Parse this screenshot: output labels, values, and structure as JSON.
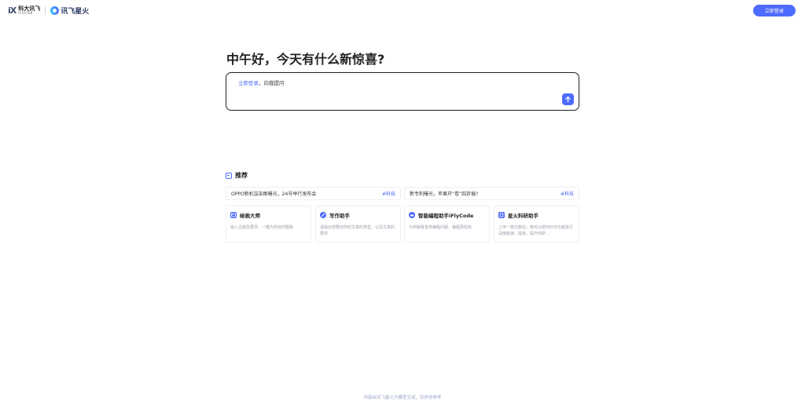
{
  "header": {
    "logo_cn": "科大讯飞",
    "logo_en": "iFLYTEK",
    "logo_x": "iX",
    "spark_name": "讯飞星火",
    "login_button": "立即登录"
  },
  "greeting": "中午好，今天有什么新惊喜?",
  "input": {
    "login_link": "立即登录",
    "hint_suffix": "，向我提问"
  },
  "recommend": {
    "title": "推荐",
    "news": [
      {
        "text": "OPPO新机渲染图曝光，24号举行发布会",
        "tag": "#科技"
      },
      {
        "text": "新专利曝光，苹果开“卷”四折痕?",
        "tag": "#科技"
      }
    ],
    "cards": [
      {
        "title": "绘画大师",
        "desc": "输入主题及要求，一键为你创作图像",
        "icon": "paint-icon",
        "color": "#4d6bfe"
      },
      {
        "title": "写作助手",
        "desc": "请提出您要创作的文章的类型，以及文章的要求",
        "icon": "pen-icon",
        "color": "#4d6bfe"
      },
      {
        "title": "智能编程助手iFlyCode",
        "desc": "为你解答各类编程问题，编程更轻松",
        "icon": "code-icon",
        "color": "#4d6bfe"
      },
      {
        "title": "星火科研助手",
        "desc": "上传一篇文献后，我可以帮你针对文献进行深度解读、提炼、提升科研…",
        "icon": "book-icon",
        "color": "#4d6bfe"
      }
    ]
  },
  "footer": "内容由讯飞星火大模型生成，仅供你参考"
}
